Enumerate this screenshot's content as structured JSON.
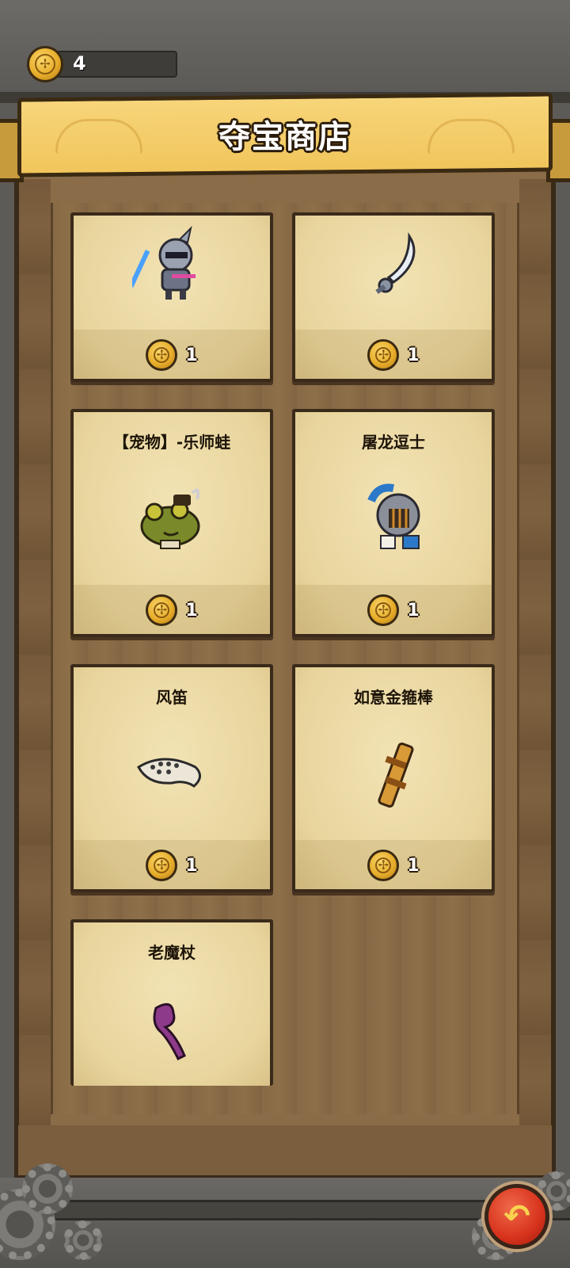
{
  "currency": {
    "count": "4",
    "icon": "gold-coin-icon"
  },
  "shop": {
    "title": "夺宝商店",
    "items": [
      {
        "name": "",
        "price": "1",
        "art": "mecha-knight-sword-icon"
      },
      {
        "name": "",
        "price": "1",
        "art": "curved-blade-icon"
      },
      {
        "name": "【宠物】-乐师蛙",
        "price": "1",
        "art": "musician-frog-pet-icon"
      },
      {
        "name": "屠龙逗士",
        "price": "1",
        "art": "armored-knight-icon"
      },
      {
        "name": "风笛",
        "price": "1",
        "art": "ocarina-flute-icon"
      },
      {
        "name": "如意金箍棒",
        "price": "1",
        "art": "golden-staff-icon"
      },
      {
        "name": "老魔杖",
        "price": "",
        "art": "purple-wand-icon"
      }
    ]
  },
  "navigation": {
    "back_icon": "back-arrow-icon"
  },
  "colors": {
    "banner": "#f4cd68",
    "parchment": "#efdfaa",
    "wood": "#8a6c48",
    "back_button": "#d7321c"
  }
}
